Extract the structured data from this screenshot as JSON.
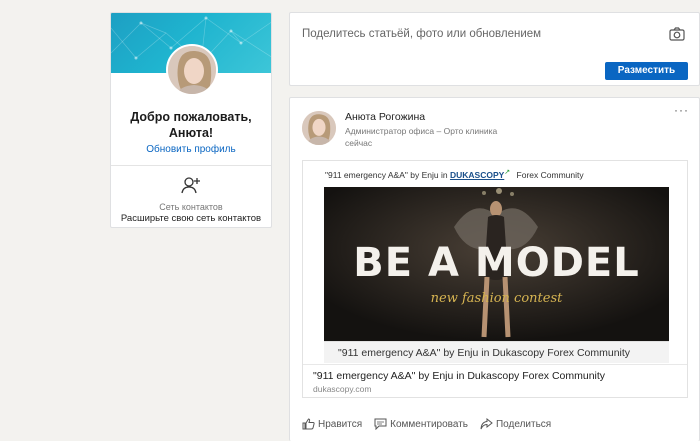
{
  "profile": {
    "welcome": "Добро пожаловать, Анюта!",
    "update_profile": "Обновить профиль",
    "network_label": "Сеть контактов",
    "network_cta": "Расширьте свою сеть контактов"
  },
  "share": {
    "placeholder": "Поделитесь статьёй, фото или обновлением",
    "post_button": "Разместить"
  },
  "post": {
    "author": "Анюта Рогожина",
    "headline": "Администратор офиса – Орто клиника",
    "time": "сейчас",
    "more": "···",
    "article": {
      "top_prefix": "\"911 emergency A&A\" by Enju in",
      "top_brand": "DUKASCOPY",
      "top_suffix": "Forex Community",
      "image_title": "BE A MODEL",
      "image_subtitle": "new fashion contest",
      "caption": "\"911 emergency A&A\" by Enju in Dukascopy Forex Community",
      "title": "\"911 emergency A&A\" by Enju in Dukascopy Forex Community",
      "domain": "dukascopy.com"
    },
    "actions": {
      "like": "Нравится",
      "comment": "Комментировать",
      "share": "Поделиться"
    }
  },
  "colors": {
    "accent": "#0a66c2",
    "banner": "#1fb4cf",
    "page_bg": "#f3f2ef"
  },
  "icons": [
    "camera-icon",
    "add-person-icon",
    "like-icon",
    "comment-icon",
    "share-icon",
    "more-icon",
    "external-link-icon"
  ]
}
